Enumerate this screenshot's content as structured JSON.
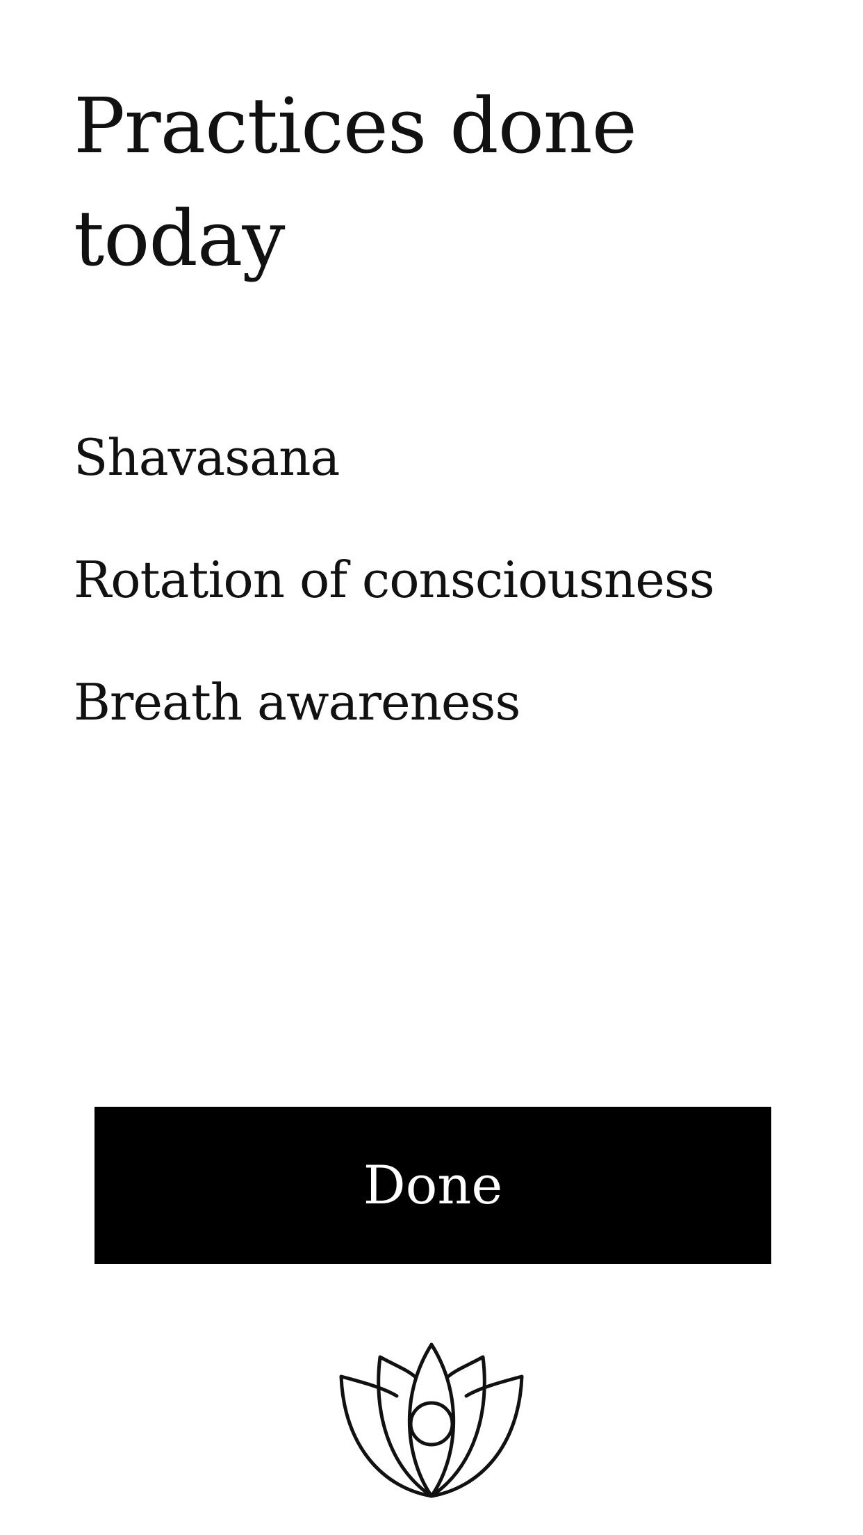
{
  "header": {
    "title": "Practices done today"
  },
  "practices": [
    {
      "label": "Shavasana"
    },
    {
      "label": "Rotation of consciousness"
    },
    {
      "label": "Breath awareness"
    }
  ],
  "actions": {
    "done_label": "Done"
  },
  "branding": {
    "logo_icon": "lotus-icon"
  },
  "colors": {
    "background": "#ffffff",
    "text": "#111111",
    "button_background": "#000000",
    "button_text": "#ffffff"
  }
}
